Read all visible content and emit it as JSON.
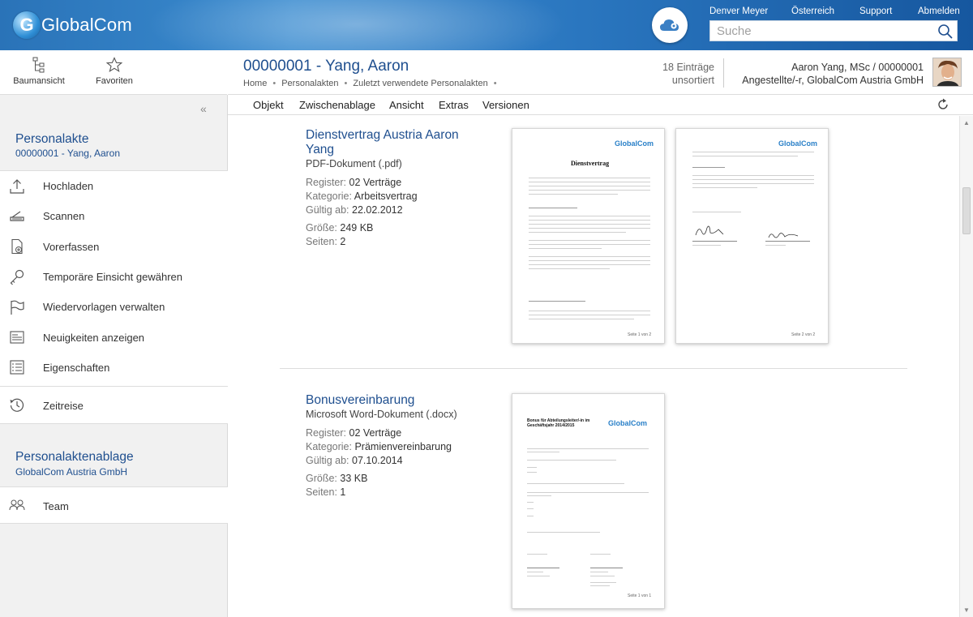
{
  "header": {
    "brand": "GlobalCom",
    "user_name": "Denver Meyer",
    "country": "Österreich",
    "support": "Support",
    "logout": "Abmelden",
    "search_placeholder": "Suche"
  },
  "tools": {
    "tree": "Baumansicht",
    "favorites": "Favoriten"
  },
  "record": {
    "title": "00000001 - Yang, Aaron",
    "breadcrumb": [
      "Home",
      "Personalakten",
      "Zuletzt verwendete Personalakten"
    ],
    "entries_line1": "18 Einträge",
    "entries_line2": "unsortiert",
    "person_line1": "Aaron Yang, MSc / 00000001",
    "person_line2": "Angestellte/-r, GlobalCom Austria GmbH"
  },
  "menu": {
    "items": [
      "Objekt",
      "Zwischenablage",
      "Ansicht",
      "Extras",
      "Versionen"
    ]
  },
  "sidebar": {
    "section1_title": "Personalakte",
    "section1_sub": "00000001 - Yang, Aaron",
    "actions": [
      {
        "label": "Hochladen",
        "icon": "upload-icon"
      },
      {
        "label": "Scannen",
        "icon": "scanner-icon"
      },
      {
        "label": "Vorerfassen",
        "icon": "document-add-icon"
      },
      {
        "label": "Temporäre Einsicht gewähren",
        "icon": "key-icon"
      },
      {
        "label": "Wiedervorlagen verwalten",
        "icon": "flag-icon"
      },
      {
        "label": "Neuigkeiten anzeigen",
        "icon": "news-icon"
      },
      {
        "label": "Eigenschaften",
        "icon": "properties-icon"
      }
    ],
    "timetravel": "Zeitreise",
    "section2_title": "Personalaktenablage",
    "section2_sub": "GlobalCom Austria GmbH",
    "team": "Team"
  },
  "documents": [
    {
      "name": "Dienstvertrag Austria Aaron Yang",
      "type": "PDF-Dokument (.pdf)",
      "register_label": "Register:",
      "register": "02 Verträge",
      "category_label": "Kategorie:",
      "category": "Arbeitsvertrag",
      "valid_label": "Gültig ab:",
      "valid": "22.02.2012",
      "size_label": "Größe:",
      "size": "249 KB",
      "pages_label": "Seiten:",
      "pages": "2"
    },
    {
      "name": "Bonusvereinbarung",
      "type": "Microsoft Word-Dokument (.docx)",
      "register_label": "Register:",
      "register": "02 Verträge",
      "category_label": "Kategorie:",
      "category": "Prämienvereinbarung",
      "valid_label": "Gültig ab:",
      "valid": "07.10.2014",
      "size_label": "Größe:",
      "size": "33 KB",
      "pages_label": "Seiten:",
      "pages": "1"
    }
  ],
  "thumbnails": {
    "contract_heading": "Dienstvertrag",
    "bonus_heading": "Bonus für Abteilungsleiter/-in im Geschäftsjahr 2014/2015",
    "page1_of2": "Seite 1 von 2",
    "page2_of2": "Seite 2 von 2",
    "page1_of1": "Seite 1 von 1"
  },
  "colors": {
    "accent": "#1f4f8f",
    "header_blue": "#2a73b8",
    "sidebar_bg": "#f1f1f1"
  }
}
